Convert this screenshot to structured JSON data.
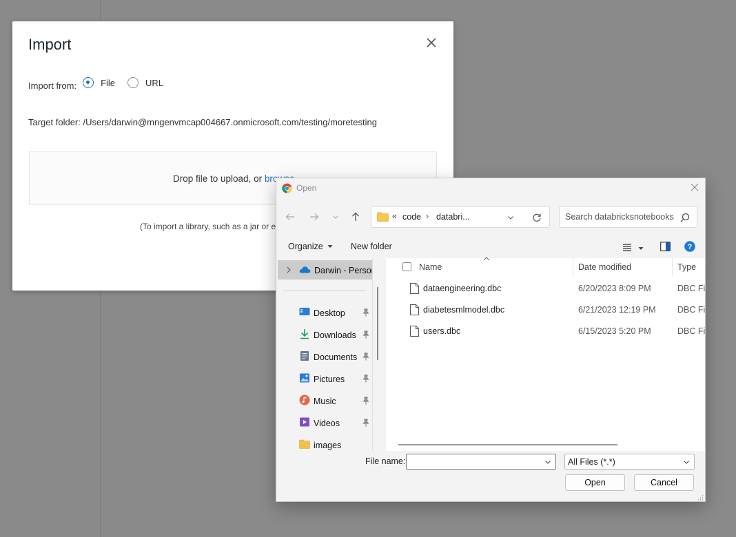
{
  "import_modal": {
    "title": "Import",
    "import_from_label": "Import from:",
    "options": [
      {
        "label": "File",
        "selected": true
      },
      {
        "label": "URL",
        "selected": false
      }
    ],
    "target_folder": "Target folder: /Users/darwin@mngenvmcap004667.onmicrosoft.com/testing/moretesting",
    "dropzone_text": "Drop file to upload, or ",
    "dropzone_link": "browse",
    "note": "(To import a library, such as a jar or egg, click here)"
  },
  "open_dialog": {
    "title": "Open",
    "address": {
      "overflow": "«",
      "segments": [
        "code",
        "databri..."
      ],
      "separator": "›"
    },
    "search_placeholder": "Search databricksnotebooks",
    "commands": {
      "organize": "Organize",
      "new_folder": "New folder"
    },
    "sidebar": {
      "top_item": "Darwin - Personal",
      "items": [
        {
          "label": "Desktop",
          "icon": "desktop-icon",
          "color": "#2b7bd8"
        },
        {
          "label": "Downloads",
          "icon": "download-icon",
          "color": "#1a9d5a"
        },
        {
          "label": "Documents",
          "icon": "documents-icon",
          "color": "#6c7a90"
        },
        {
          "label": "Pictures",
          "icon": "pictures-icon",
          "color": "#2b7bd8"
        },
        {
          "label": "Music",
          "icon": "music-icon",
          "color": "#e06a4a"
        },
        {
          "label": "Videos",
          "icon": "videos-icon",
          "color": "#7b4fc9"
        },
        {
          "label": "images",
          "icon": "folder-icon",
          "color": "#f2c14e"
        }
      ]
    },
    "columns": {
      "name": "Name",
      "date": "Date modified",
      "type": "Type"
    },
    "files": [
      {
        "name": "dataengineering.dbc",
        "date": "6/20/2023 8:09 PM",
        "type": "DBC File"
      },
      {
        "name": "diabetesmlmodel.dbc",
        "date": "6/21/2023 12:19 PM",
        "type": "DBC File"
      },
      {
        "name": "users.dbc",
        "date": "6/15/2023 5:20 PM",
        "type": "DBC File"
      }
    ],
    "file_name_label": "File name:",
    "file_name_value": "",
    "filter": "All Files (*.*)",
    "open_label": "Open",
    "cancel_label": "Cancel"
  }
}
